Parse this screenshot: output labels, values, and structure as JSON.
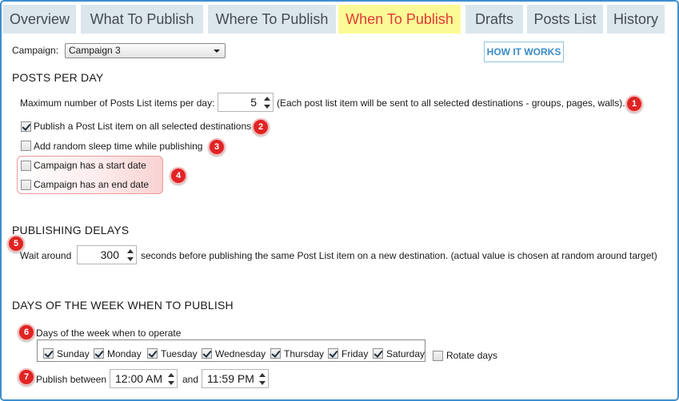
{
  "tabs": [
    {
      "label": "Overview",
      "active": false
    },
    {
      "label": "What To Publish",
      "active": false
    },
    {
      "label": "Where To Publish",
      "active": false
    },
    {
      "label": "When To Publish",
      "active": true
    },
    {
      "label": "Drafts",
      "active": false
    },
    {
      "label": "Posts List",
      "active": false
    },
    {
      "label": "History",
      "active": false
    }
  ],
  "campaign": {
    "label": "Campaign:",
    "selected": "Campaign 3"
  },
  "how_it_works": "HOW IT WORKS",
  "posts_per_day": {
    "title": "POSTS PER DAY",
    "max_label": "Maximum number of Posts List items per day:",
    "max_value": "5",
    "max_note": "(Each post list item will be sent to all selected destinations - groups, pages, walls).",
    "publish_all": {
      "label": "Publish a Post List item on all selected destinations",
      "checked": true
    },
    "random_sleep": {
      "label": "Add random sleep time while publishing",
      "checked": false
    },
    "start_date": {
      "label": "Campaign has a start date",
      "checked": false
    },
    "end_date": {
      "label": "Campaign has an end date",
      "checked": false
    }
  },
  "publishing_delays": {
    "title": "PUBLISHING DELAYS",
    "wait_label": "Wait around",
    "wait_value": "300",
    "wait_note": "seconds before publishing the same Post List item on a new destination. (actual value is chosen at random around target)"
  },
  "days": {
    "title": "DAYS OF THE WEEK WHEN TO PUBLISH",
    "operate_label": "Days of the week when to operate",
    "list": [
      {
        "label": "Sunday",
        "checked": true
      },
      {
        "label": "Monday",
        "checked": true
      },
      {
        "label": "Tuesday",
        "checked": true
      },
      {
        "label": "Wednesday",
        "checked": true
      },
      {
        "label": "Thursday",
        "checked": true
      },
      {
        "label": "Friday",
        "checked": true
      },
      {
        "label": "Saturday",
        "checked": true
      }
    ],
    "rotate": {
      "label": "Rotate days",
      "checked": false
    },
    "publish_between": "Publish between",
    "start_time": "12:00 AM",
    "and": "and",
    "end_time": "11:59 PM"
  },
  "badges": [
    "1",
    "2",
    "3",
    "4",
    "5",
    "6",
    "7"
  ],
  "colors": {
    "frame": "#3d8fd0",
    "tab_bg": "#dbe7ed",
    "active_tab_bg": "#fafa96",
    "active_tab_text": "#e23a38",
    "badge": "#e02424",
    "link": "#3a8cc4"
  }
}
